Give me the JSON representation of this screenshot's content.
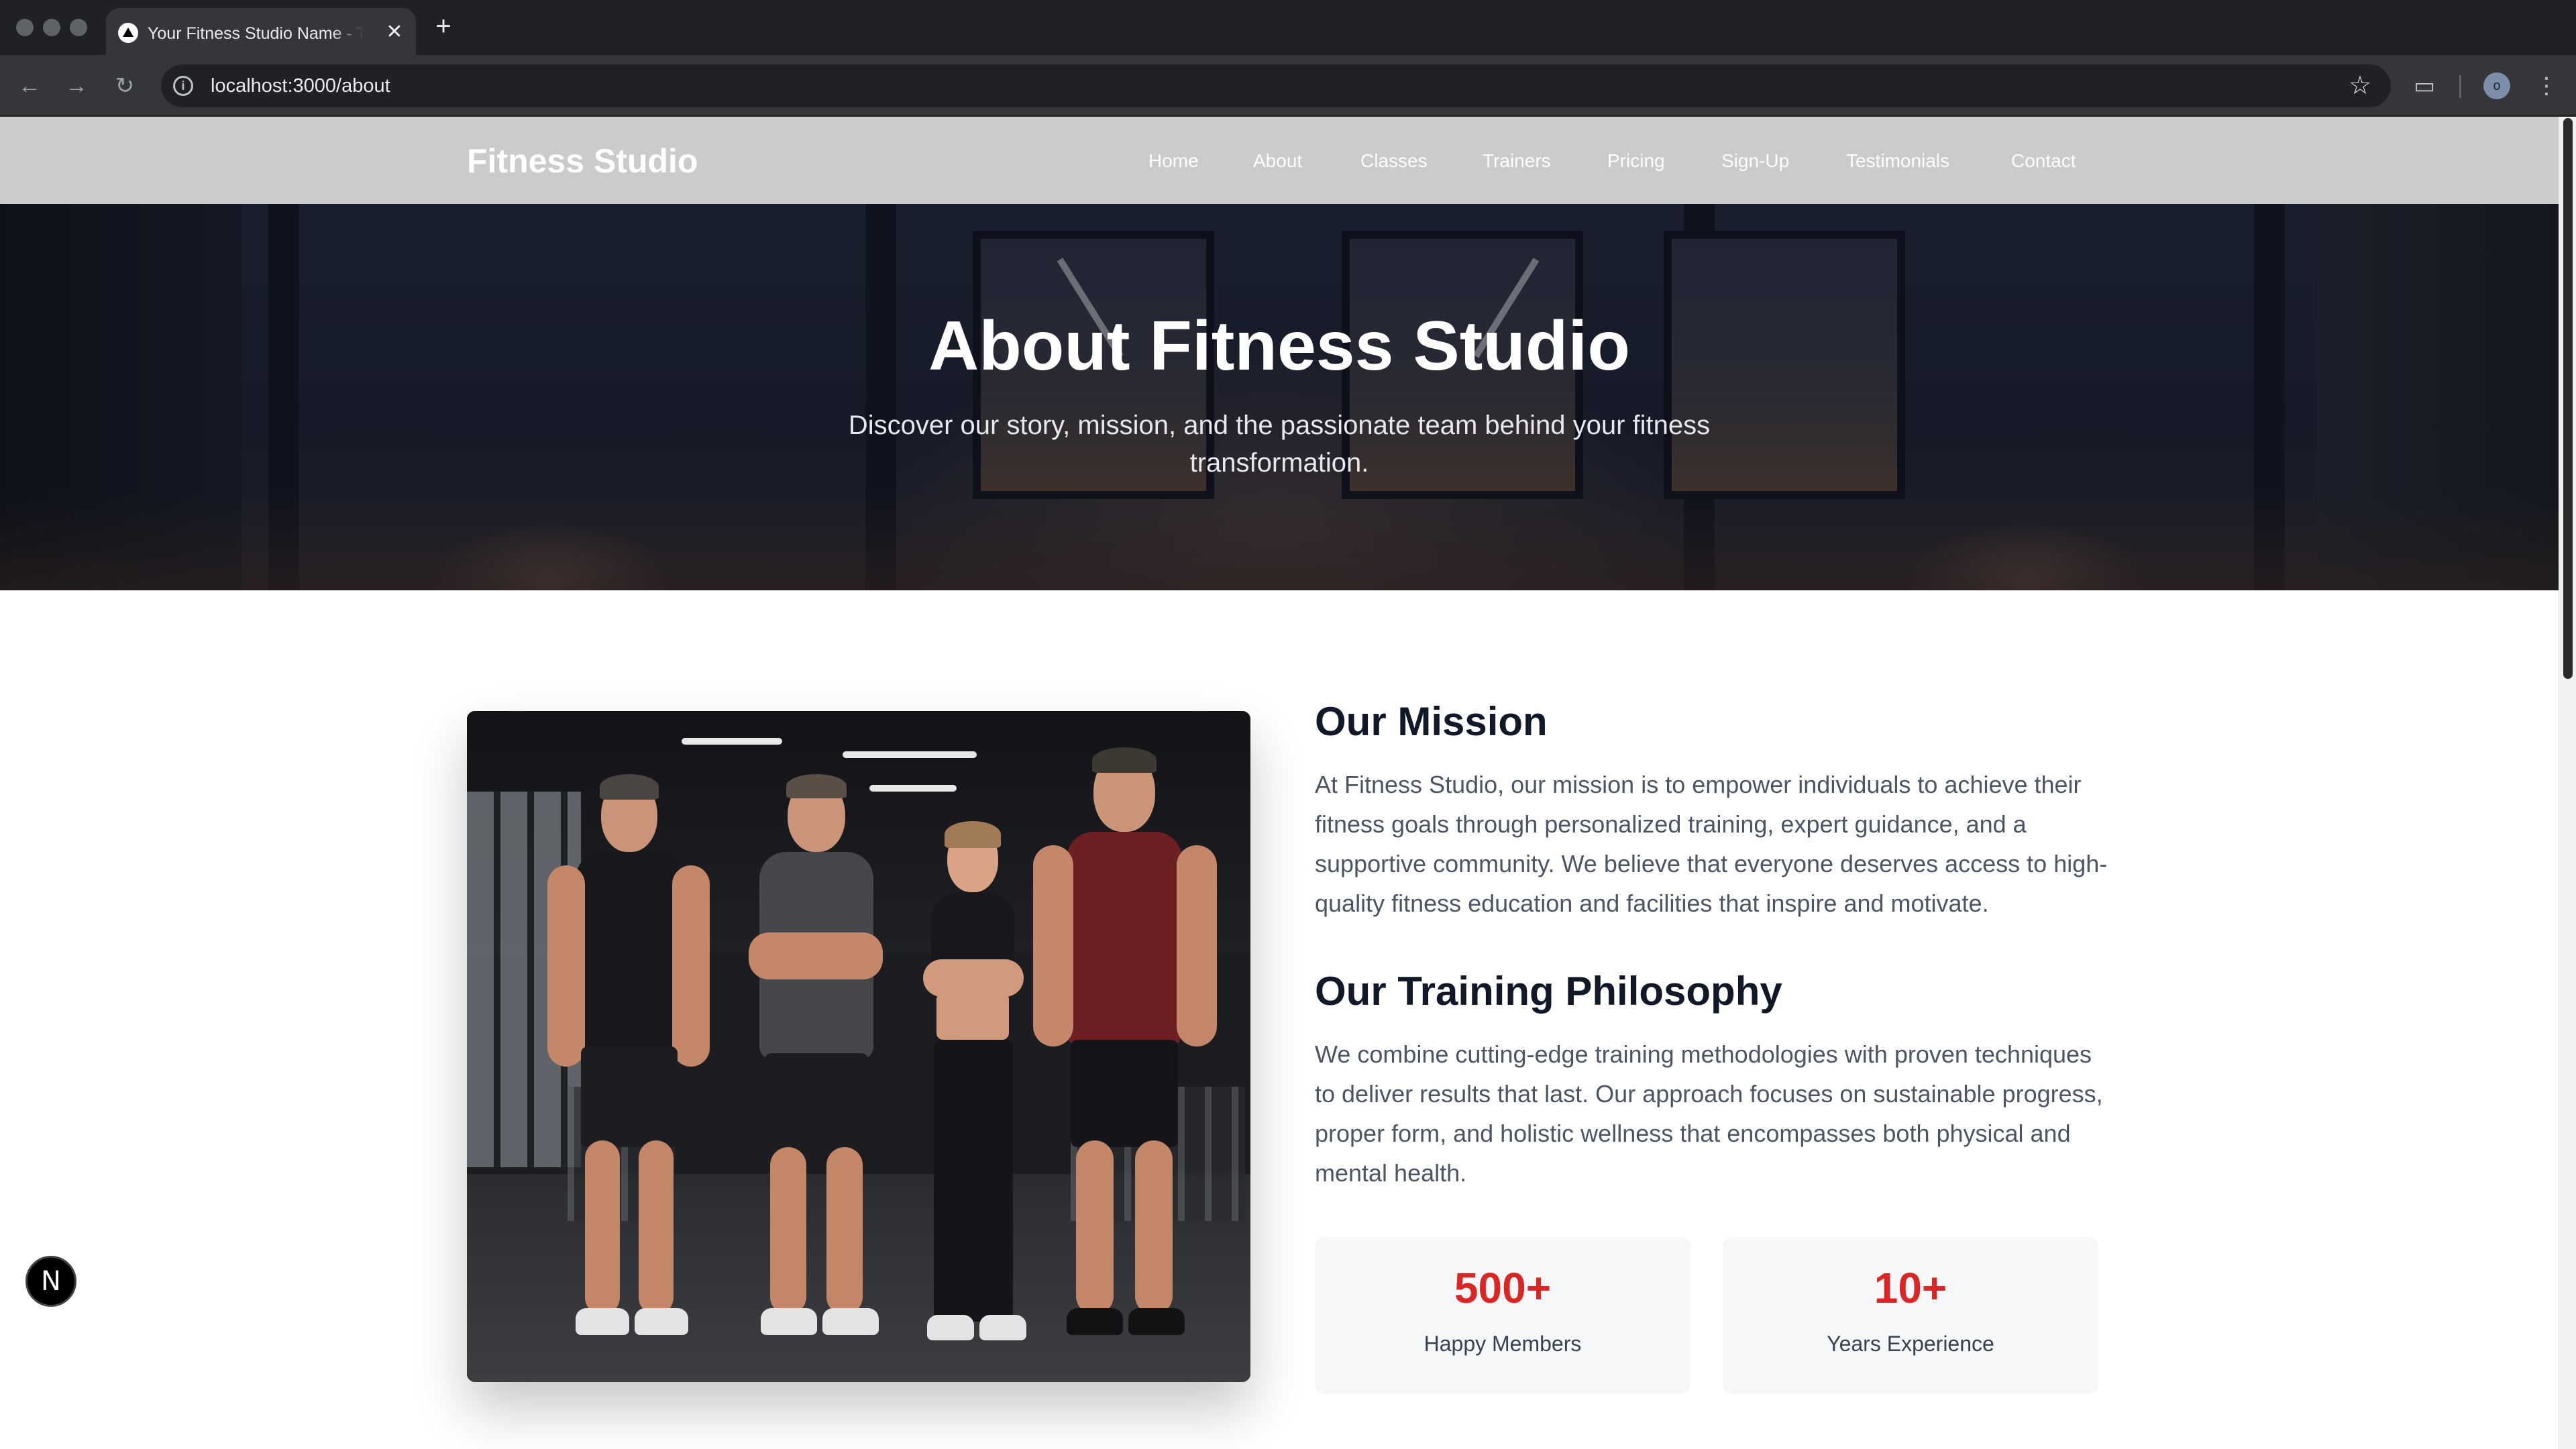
{
  "browser": {
    "tab_title": "Your Fitness Studio Name - Transform Your Body",
    "tab_close_glyph": "✕",
    "new_tab_glyph": "+",
    "back_glyph": "←",
    "forward_glyph": "→",
    "reload_glyph": "↻",
    "info_glyph": "i",
    "url": "localhost:3000/about",
    "star_glyph": "☆",
    "cast_glyph": "▭",
    "profile_initial": "o",
    "menu_glyph": "⋮"
  },
  "nav": {
    "brand": "Fitness Studio",
    "links": [
      "Home",
      "About",
      "Classes",
      "Trainers",
      "Pricing",
      "Sign-Up",
      "Testimonials",
      "Contact"
    ]
  },
  "hero": {
    "title": "About Fitness Studio",
    "subtitle": "Discover our story, mission, and the passionate team behind your fitness transformation."
  },
  "about": {
    "mission_heading": "Our Mission",
    "mission_text": "At Fitness Studio, our mission is to empower individuals to achieve their fitness goals through personalized training, expert guidance, and a supportive community. We believe that everyone deserves access to high-quality fitness education and facilities that inspire and motivate.",
    "philosophy_heading": "Our Training Philosophy",
    "philosophy_text": "We combine cutting-edge training methodologies with proven techniques to deliver results that last. Our approach focuses on sustainable progress, proper form, and holistic wellness that encompasses both physical and mental health.",
    "stats": [
      {
        "value": "500+",
        "label": "Happy Members"
      },
      {
        "value": "10+",
        "label": "Years Experience"
      }
    ]
  },
  "dev_badge": "N",
  "colors": {
    "accent": "#dc2626",
    "nav_bg": "#cbcbcb",
    "heading": "#111827",
    "body_text": "#4b5563"
  }
}
